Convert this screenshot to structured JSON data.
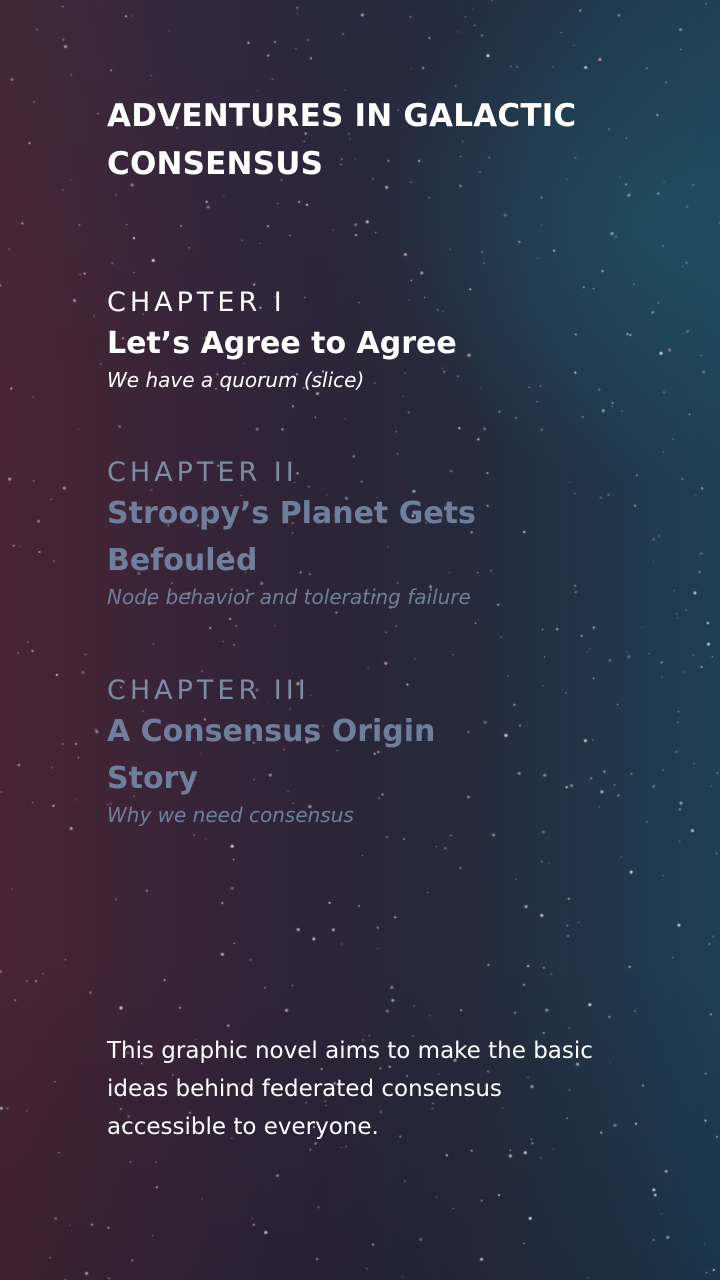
{
  "title": "ADVENTURES IN GALACTIC CONSENSUS",
  "chapters": [
    {
      "number": "CHAPTER I",
      "title": "Let’s Agree to Agree",
      "subtitle": "We have a quorum (slice)",
      "state": "active"
    },
    {
      "number": "CHAPTER II",
      "title": "Stroopy’s Planet Gets Befouled",
      "subtitle": "Node behavior and tolerating failure",
      "state": "inactive"
    },
    {
      "number": "CHAPTER III",
      "title": "A Consensus Origin Story",
      "subtitle": "Why we need consensus",
      "state": "inactive"
    }
  ],
  "description": "This graphic novel aims to make the basic ideas behind federated consensus accessible to everyone.",
  "colors": {
    "active_text": "#ffffff",
    "inactive_text": "#6f7f9b",
    "background_left": "#4a2433",
    "background_right": "#1e3f55"
  }
}
